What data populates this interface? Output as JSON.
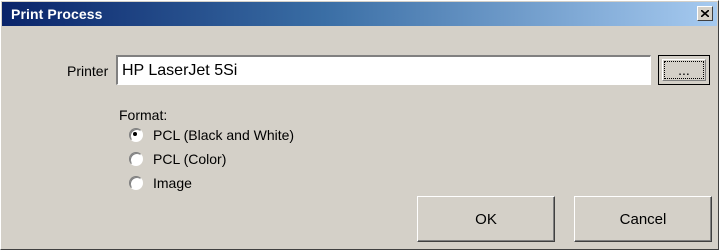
{
  "window": {
    "title": "Print Process",
    "close_icon": "close-icon"
  },
  "printer": {
    "label": "Printer",
    "value": "HP LaserJet 5Si",
    "browse_label": "..."
  },
  "format": {
    "label": "Format:",
    "options": [
      {
        "label": "PCL (Black and White)",
        "selected": true
      },
      {
        "label": "PCL (Color)",
        "selected": false
      },
      {
        "label": "Image",
        "selected": false
      }
    ]
  },
  "buttons": {
    "ok_label": "OK",
    "cancel_label": "Cancel"
  },
  "colors": {
    "title_start": "#0a246a",
    "title_end": "#a6caf0",
    "face": "#d4d0c8"
  }
}
